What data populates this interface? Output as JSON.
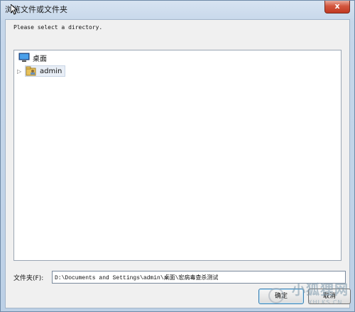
{
  "window": {
    "title": "浏览文件或文件夹",
    "close_label": "x"
  },
  "dialog": {
    "prompt": "Please select a directory.",
    "tree": [
      {
        "label": "桌面",
        "icon": "desktop-icon"
      },
      {
        "label": "admin",
        "icon": "user-folder-icon",
        "expander": "▷"
      }
    ],
    "path_label": "文件夹(F):",
    "path_value": "D:\\Documents and Settings\\admin\\桌面\\宏病毒查杀测试",
    "ok_label": "确定",
    "cancel_label": "取消"
  },
  "watermark": {
    "text": "小狐狸网",
    "sub": "XHLKS.CN"
  },
  "colors": {
    "title_gradient": "#c6d7ea",
    "close_button": "#c23a22",
    "client_bg": "#f0f0f0",
    "tree_bg": "#ffffff"
  }
}
